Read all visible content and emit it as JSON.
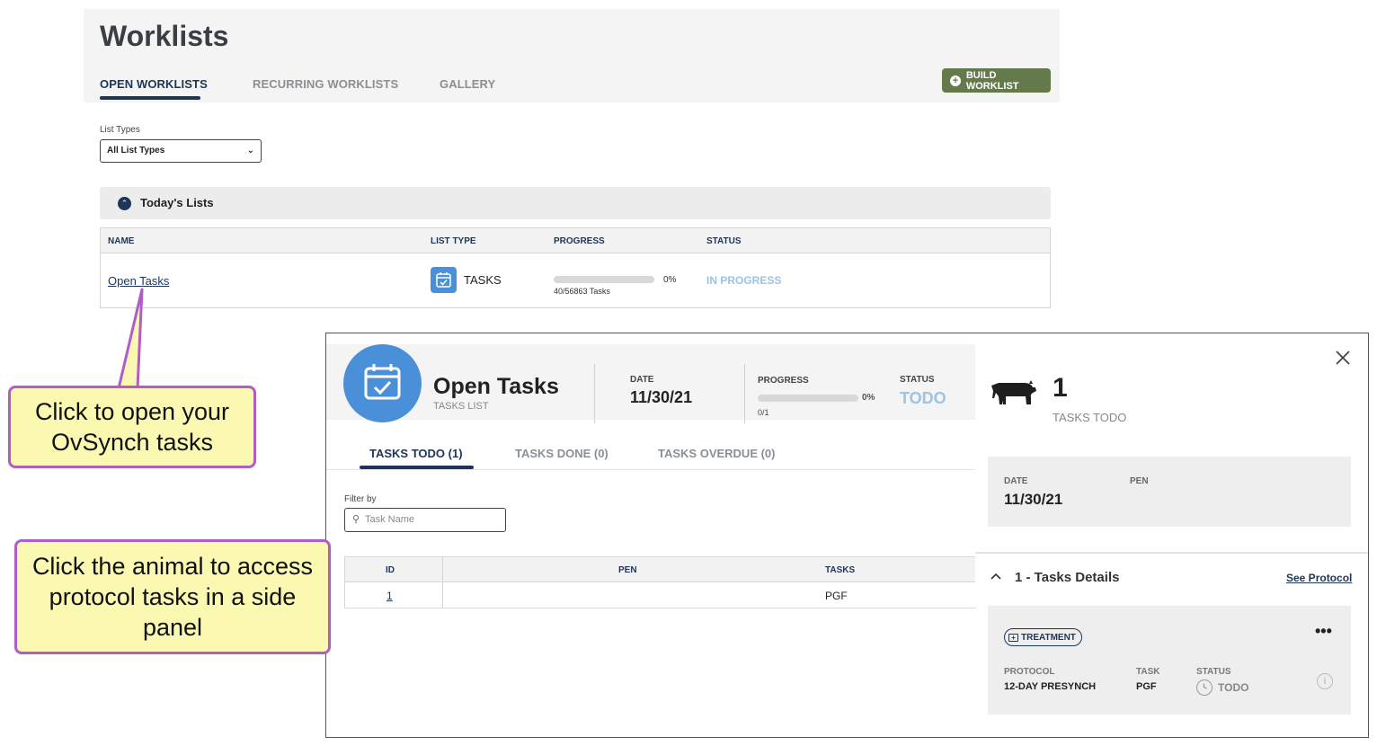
{
  "page": {
    "title": "Worklists",
    "tabs": [
      "OPEN WORKLISTS",
      "RECURRING WORKLISTS",
      "GALLERY"
    ],
    "build_button": "BUILD WORKLIST",
    "list_types_label": "List Types",
    "list_types_value": "All List Types",
    "section_title": "Today's Lists",
    "table_headers": [
      "NAME",
      "LIST TYPE",
      "PROGRESS",
      "STATUS"
    ],
    "row": {
      "name": "Open Tasks",
      "type": "TASKS",
      "progress_percent": "0%",
      "progress_value": 0,
      "progress_count": "40/56863 Tasks",
      "status": "IN PROGRESS"
    }
  },
  "callouts": {
    "first": "Click to open your OvSynch tasks",
    "second": "Click the animal to access protocol tasks in a side panel"
  },
  "panel": {
    "title": "Open Tasks",
    "subtitle": "TASKS LIST",
    "date_label": "DATE",
    "date": "11/30/21",
    "progress_label": "PROGRESS",
    "progress_percent": "0%",
    "progress_value": 0,
    "progress_count": "0/1",
    "status_label": "STATUS",
    "status": "TODO",
    "tabs": [
      "TASKS TODO (1)",
      "TASKS DONE (0)",
      "TASKS OVERDUE (0)"
    ],
    "filter_label": "Filter by",
    "filter_placeholder": "Task Name",
    "table_headers": [
      "ID",
      "PEN",
      "TASKS"
    ],
    "rows": [
      {
        "id": "1",
        "pen": "",
        "task": "PGF"
      }
    ]
  },
  "side_panel": {
    "count": "1",
    "count_label": "TASKS TODO",
    "date_label": "DATE",
    "pen_label": "PEN",
    "date": "11/30/21",
    "details_title": "1 - Tasks Details",
    "see_protocol": "See Protocol",
    "badge": "TREATMENT",
    "more": "•••",
    "protocol_label": "PROTOCOL",
    "protocol": "12-DAY PRESYNCH",
    "task_label": "TASK",
    "task": "PGF",
    "status_label": "STATUS",
    "status": "TODO"
  },
  "colors": {
    "navy": "#1d3557",
    "button_green": "#657a4b",
    "calendar_blue": "#4a90d9",
    "status_blue": "#9cc3e2",
    "callout_fill": "#fbf8b2",
    "callout_border": "#b25cc8"
  },
  "icons": [
    "plus-circle-icon",
    "chevron-down-icon",
    "chevron-up-icon",
    "calendar-check-icon",
    "close-icon",
    "cow-icon",
    "search-icon",
    "first-aid-kit-icon",
    "clock-icon",
    "info-icon",
    "more-horizontal-icon"
  ]
}
